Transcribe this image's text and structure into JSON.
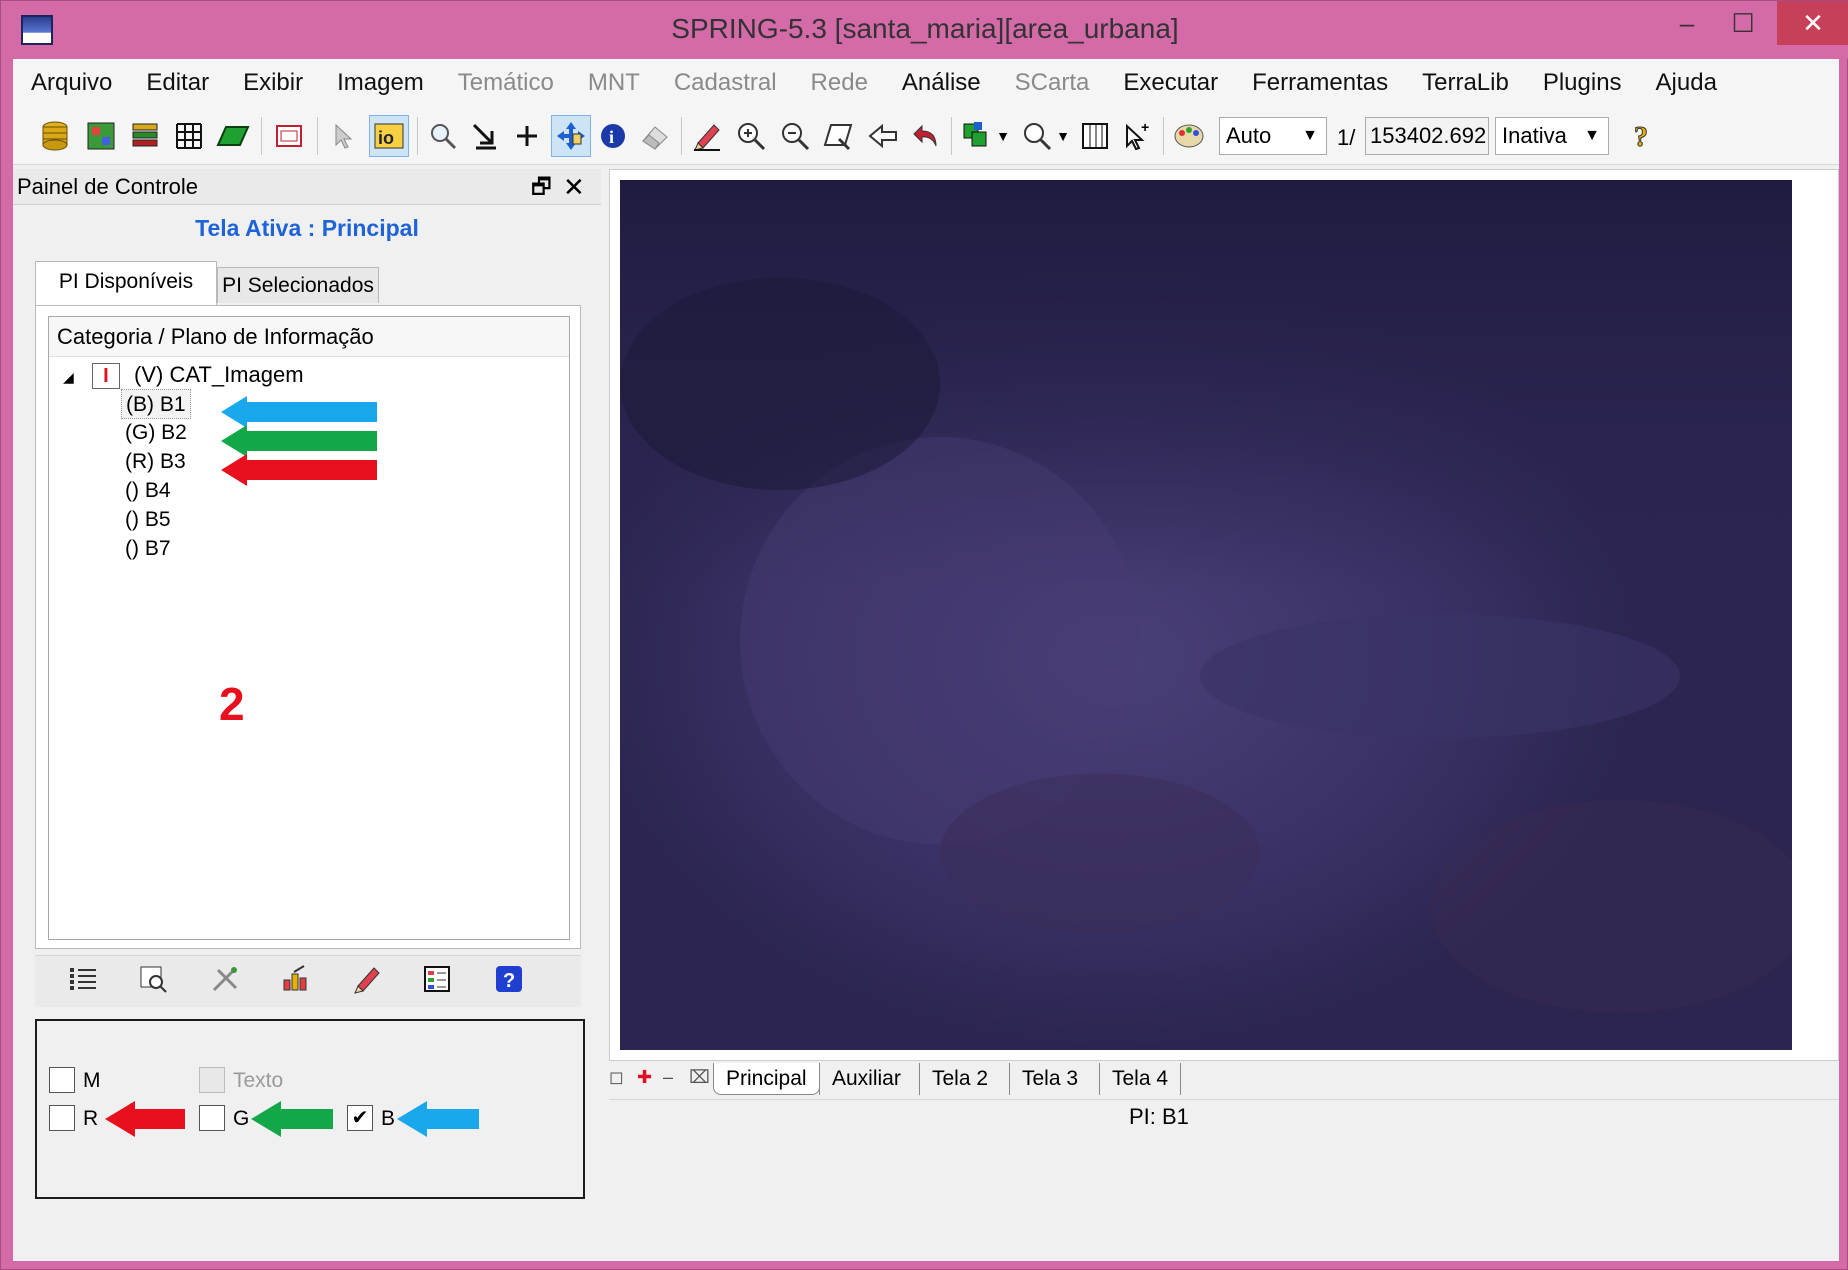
{
  "window": {
    "title": "SPRING-5.3 [santa_maria][area_urbana]",
    "minimize": "–",
    "maximize": "☐",
    "close": "✕"
  },
  "menu": [
    {
      "label": "Arquivo",
      "enabled": true
    },
    {
      "label": "Editar",
      "enabled": true
    },
    {
      "label": "Exibir",
      "enabled": true
    },
    {
      "label": "Imagem",
      "enabled": true
    },
    {
      "label": "Temático",
      "enabled": false
    },
    {
      "label": "MNT",
      "enabled": false
    },
    {
      "label": "Cadastral",
      "enabled": false
    },
    {
      "label": "Rede",
      "enabled": false
    },
    {
      "label": "Análise",
      "enabled": true
    },
    {
      "label": "SCarta",
      "enabled": false
    },
    {
      "label": "Executar",
      "enabled": true
    },
    {
      "label": "Ferramentas",
      "enabled": true
    },
    {
      "label": "TerraLib",
      "enabled": true
    },
    {
      "label": "Plugins",
      "enabled": true
    },
    {
      "label": "Ajuda",
      "enabled": true
    }
  ],
  "toolbar": {
    "scale_mode": "Auto",
    "scale_prefix": "1/",
    "scale_value": "153402.692",
    "state": "Inativa",
    "icons": [
      "database-icon",
      "image-catalog-icon",
      "layers-icon",
      "grid-icon",
      "polygon-icon",
      "frame-icon",
      "cursor-icon",
      "info-pointer-icon",
      "search-icon",
      "import-arrow-icon",
      "plus-icon",
      "pan-icon",
      "info-icon",
      "eraser-icon",
      "pencil-icon",
      "zoom-in-icon",
      "zoom-out-icon",
      "zoom-area-icon",
      "back-icon",
      "undo-icon",
      "tile-icon",
      "zoom-scale-icon",
      "table-icon",
      "select-pointer-icon",
      "palette-icon",
      "help-icon"
    ]
  },
  "panel": {
    "title": "Painel de Controle",
    "float_icon": "🗗",
    "close_icon": "✕",
    "active_screen": "Tela Ativa : Principal",
    "tabs": [
      "PI Disponíveis",
      "PI Selecionados"
    ],
    "tree_header": "Categoria / Plano de Informação",
    "category": "(V) CAT_Imagem",
    "category_icon": "I",
    "items": [
      "(B) B1",
      "(G) B2",
      "(R) B3",
      "() B4",
      "() B5",
      "() B7"
    ],
    "annotation_number": "2",
    "checkboxes": {
      "m": {
        "label": "M",
        "checked": false
      },
      "texto": {
        "label": "Texto",
        "checked": false
      },
      "r": {
        "label": "R",
        "checked": false
      },
      "g": {
        "label": "G",
        "checked": false
      },
      "b": {
        "label": "B",
        "checked": true
      }
    }
  },
  "colors": {
    "arrow_blue": "#1aa8ec",
    "arrow_green": "#12a84a",
    "arrow_red": "#e8101e",
    "image_bg": "#2b2550"
  },
  "bottom_tabs": [
    "Principal",
    "Auxiliar",
    "Tela 2",
    "Tela 3",
    "Tela 4"
  ],
  "status": "PI: B1"
}
